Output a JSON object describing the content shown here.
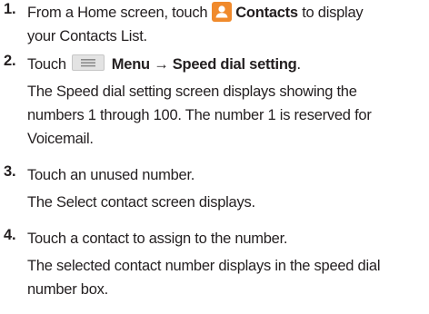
{
  "steps": [
    {
      "number": "1.",
      "parts": {
        "before": "From a Home screen, touch",
        "icon": "contacts-icon",
        "bold": "Contacts",
        "after": "to display",
        "line2": "your Contacts List."
      }
    },
    {
      "number": "2.",
      "parts": {
        "before": "Touch",
        "icon": "menu-icon",
        "bold": "Menu → Speed dial setting",
        "after": "."
      },
      "desc": [
        "The Speed dial setting screen displays showing the",
        "numbers 1 through 100. The number 1 is reserved for",
        "Voicemail."
      ]
    },
    {
      "number": "3.",
      "text": "Touch an unused number.",
      "desc": [
        "The Select contact screen displays."
      ]
    },
    {
      "number": "4.",
      "text": "Touch a contact to assign to the number.",
      "desc": [
        "The selected contact number displays in the speed dial",
        "number box."
      ]
    }
  ],
  "colors": {
    "text": "#231f20",
    "contacts_icon_bg": "#f08a2c",
    "menu_icon_bg": "#e3e3e3"
  }
}
